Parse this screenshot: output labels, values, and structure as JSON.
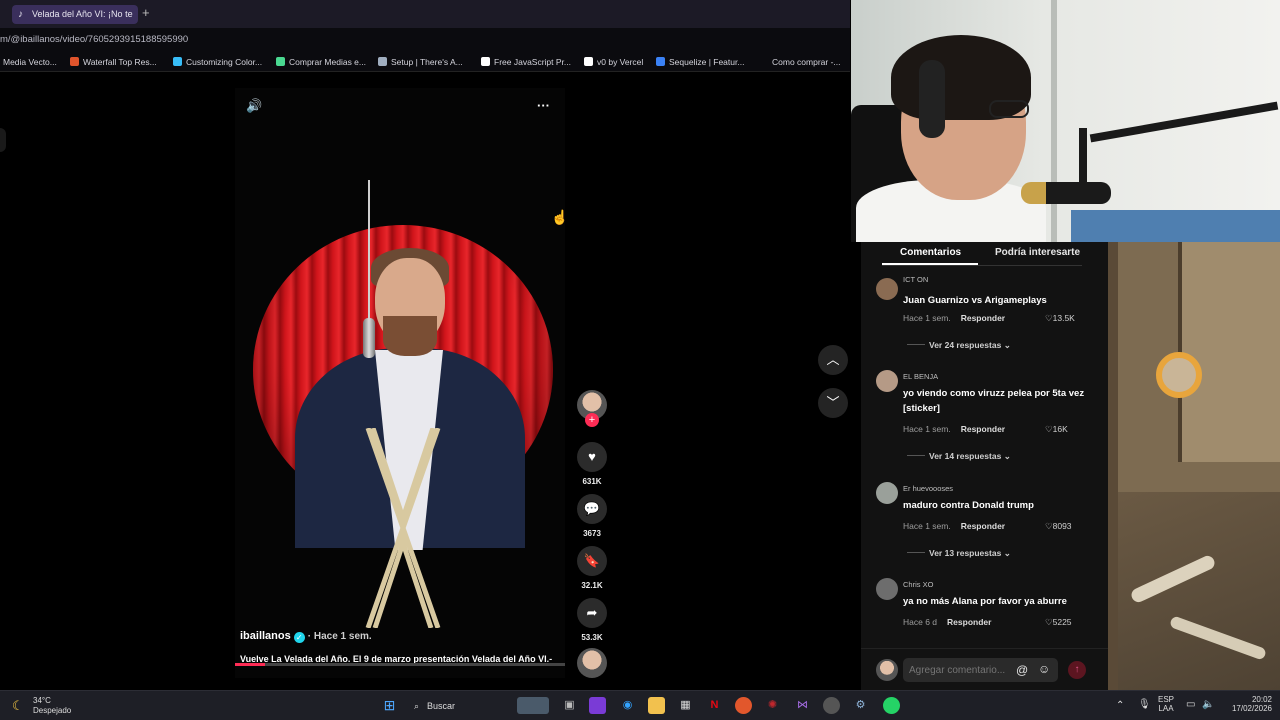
{
  "browser": {
    "tab_title": "Velada del Año VI: ¡No te",
    "new_tab": "+",
    "url": "m/@ibaillanos/video/7605293915188595990",
    "bookmarks": [
      {
        "label": "Media Vecto...",
        "color": "#3b3b3b"
      },
      {
        "label": "Waterfall Top Res...",
        "color": "#e0542c"
      },
      {
        "label": "Customizing Color...",
        "color": "#38bdf8"
      },
      {
        "label": "Comprar Medias e...",
        "color": "#4ad991"
      },
      {
        "label": "Setup | There's A...",
        "color": "#a0aec0"
      },
      {
        "label": "Free JavaScript Pr...",
        "color": "#ffffff"
      },
      {
        "label": "v0 by Vercel",
        "color": "#ffffff"
      },
      {
        "label": "Sequelize | Featur...",
        "color": "#3b82f6"
      },
      {
        "label": "Como comprar -...",
        "color": "#111111"
      }
    ]
  },
  "video": {
    "author": "ibaillanos",
    "time": "· Hace 1 sem.",
    "caption": "Vuelve La Velada del Año. El 9 de marzo presentación Velada del Año VI.-",
    "progress": 0.09,
    "actions": {
      "likes": "631K",
      "comments": "3673",
      "saves": "32.1K",
      "shares": "53.3K"
    },
    "accent": "#fe2c55"
  },
  "comments_panel": {
    "tab_comments": "Comentarios",
    "tab_related": "Podría interesarte",
    "comments": [
      {
        "user": "ICT ON",
        "text": "Juan Guarnizo vs Arigameplays",
        "time": "Hace 1 sem.",
        "reply": "Responder",
        "likes": "13.5K",
        "more": "Ver 24 respuestas"
      },
      {
        "user": "EL BENJA",
        "text": "yo viendo como viruzz pelea por 5ta vez [sticker]",
        "time": "Hace 1 sem.",
        "reply": "Responder",
        "likes": "16K",
        "more": "Ver 14 respuestas"
      },
      {
        "user": "Er huevoooses",
        "text": "maduro contra Donald trump",
        "time": "Hace 1 sem.",
        "reply": "Responder",
        "likes": "8093",
        "more": "Ver 13 respuestas"
      },
      {
        "user": "Chris XO",
        "text": "ya no más Alana por favor ya aburre",
        "time": "Hace 6 d",
        "reply": "Responder",
        "likes": "5225",
        "more": ""
      }
    ],
    "composer_placeholder": "Agregar comentario..."
  },
  "taskbar": {
    "temperature": "34°C",
    "condition": "Despejado",
    "search_label": "Buscar",
    "lang_top": "ESP",
    "lang_bottom": "LAA",
    "time": "20:02",
    "date": "17/02/2026"
  }
}
